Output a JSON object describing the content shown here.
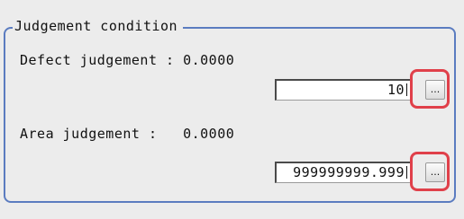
{
  "group": {
    "title": "Judgement condition"
  },
  "defect": {
    "label": "Defect judgement : 0.0000",
    "value": "10",
    "button": "..."
  },
  "area": {
    "label": "Area judgement :   0.0000",
    "value": "999999999.999",
    "button": "..."
  },
  "colors": {
    "frame": "#5b7cc0",
    "highlight": "#e0404a"
  }
}
